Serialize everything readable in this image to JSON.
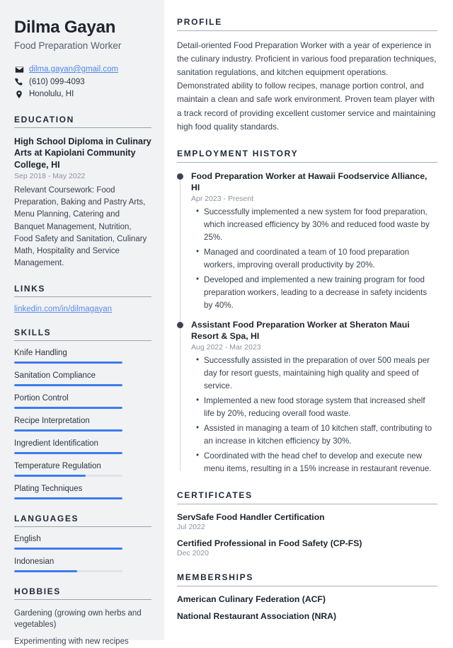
{
  "sidebar": {
    "name": "Dilma Gayan",
    "job_title": "Food Preparation Worker",
    "contacts": [
      {
        "icon": "envelope-icon",
        "value": "dilma.gayan@gmail.com",
        "is_link": true
      },
      {
        "icon": "phone-icon",
        "value": "(610) 099-4093",
        "is_link": false
      },
      {
        "icon": "location-pin-icon",
        "value": "Honolulu, HI",
        "is_link": false
      }
    ],
    "education": {
      "heading": "EDUCATION",
      "degree": "High School Diploma in Culinary Arts at Kapiolani Community College, HI",
      "date": "Sep 2018 - May 2022",
      "description": "Relevant Coursework: Food Preparation, Baking and Pastry Arts, Menu Planning, Catering and Banquet Management, Nutrition, Food Safety and Sanitation, Culinary Math, Hospitality and Service Management."
    },
    "links": {
      "heading": "LINKS",
      "items": [
        {
          "label": "linkedin.com/in/dilmagayan"
        }
      ]
    },
    "skills": {
      "heading": "SKILLS",
      "items": [
        {
          "label": "Knife Handling",
          "level": 100
        },
        {
          "label": "Sanitation Compliance",
          "level": 100
        },
        {
          "label": "Portion Control",
          "level": 100
        },
        {
          "label": "Recipe Interpretation",
          "level": 100
        },
        {
          "label": "Ingredient Identification",
          "level": 100
        },
        {
          "label": "Temperature Regulation",
          "level": 66
        },
        {
          "label": "Plating Techniques",
          "level": 100
        }
      ]
    },
    "languages": {
      "heading": "LANGUAGES",
      "items": [
        {
          "label": "English",
          "level": 100
        },
        {
          "label": "Indonesian",
          "level": 58
        }
      ]
    },
    "hobbies": {
      "heading": "HOBBIES",
      "items": [
        "Gardening (growing own herbs and vegetables)",
        "Experimenting with new recipes"
      ]
    }
  },
  "main": {
    "profile": {
      "heading": "PROFILE",
      "text": "Detail-oriented Food Preparation Worker with a year of experience in the culinary industry. Proficient in various food preparation techniques, sanitation regulations, and kitchen equipment operations. Demonstrated ability to follow recipes, manage portion control, and maintain a clean and safe work environment. Proven team player with a track record of providing excellent customer service and maintaining high food quality standards."
    },
    "employment": {
      "heading": "EMPLOYMENT HISTORY",
      "jobs": [
        {
          "role": "Food Preparation Worker at Hawaii Foodservice Alliance, HI",
          "date": "Apr 2023 - Present",
          "points": [
            "Successfully implemented a new system for food preparation, which increased efficiency by 30% and reduced food waste by 25%.",
            "Managed and coordinated a team of 10 food preparation workers, improving overall productivity by 20%.",
            "Developed and implemented a new training program for food preparation workers, leading to a decrease in safety incidents by 40%."
          ]
        },
        {
          "role": "Assistant Food Preparation Worker at Sheraton Maui Resort & Spa, HI",
          "date": "Aug 2022 - Mar 2023",
          "points": [
            "Successfully assisted in the preparation of over 500 meals per day for resort guests, maintaining high quality and speed of service.",
            "Implemented a new food storage system that increased shelf life by 20%, reducing overall food waste.",
            "Assisted in managing a team of 10 kitchen staff, contributing to an increase in kitchen efficiency by 30%.",
            "Coordinated with the head chef to develop and execute new menu items, resulting in a 15% increase in restaurant revenue."
          ]
        }
      ]
    },
    "certificates": {
      "heading": "CERTIFICATES",
      "items": [
        {
          "name": "ServSafe Food Handler Certification",
          "date": "Jul 2022"
        },
        {
          "name": "Certified Professional in Food Safety (CP-FS)",
          "date": "Dec 2020"
        }
      ]
    },
    "memberships": {
      "heading": "MEMBERSHIPS",
      "items": [
        "American Culinary Federation (ACF)",
        "National Restaurant Association (NRA)"
      ]
    }
  },
  "colors": {
    "accent_blue": "#3b7bf0",
    "link_blue": "#5b8bea",
    "sidebar_bg": "#f1f2f4",
    "heading": "#22293a"
  }
}
